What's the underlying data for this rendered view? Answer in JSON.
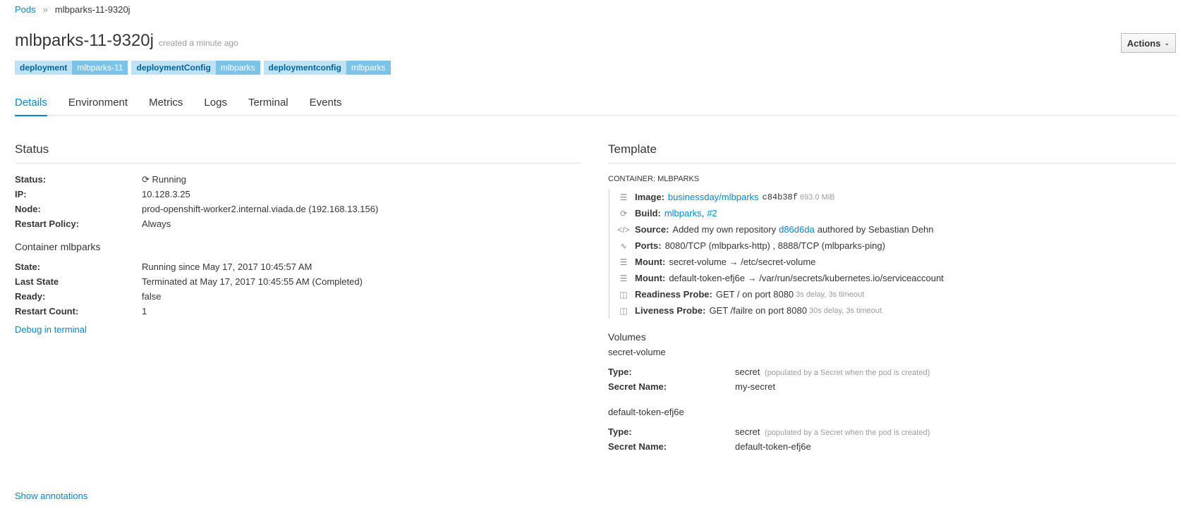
{
  "breadcrumb": {
    "parent": "Pods",
    "separator": "»",
    "current": "mlbparks-11-9320j"
  },
  "header": {
    "title": "mlbparks-11-9320j",
    "created": "created a minute ago",
    "actions_label": "Actions"
  },
  "labels": [
    {
      "key": "deployment",
      "value": "mlbparks-11"
    },
    {
      "key": "deploymentConfig",
      "value": "mlbparks"
    },
    {
      "key": "deploymentconfig",
      "value": "mlbparks"
    }
  ],
  "tabs": [
    "Details",
    "Environment",
    "Metrics",
    "Logs",
    "Terminal",
    "Events"
  ],
  "status": {
    "title": "Status",
    "rows": [
      {
        "key": "Status:",
        "value": "Running"
      },
      {
        "key": "IP:",
        "value": "10.128.3.25"
      },
      {
        "key": "Node:",
        "value": "prod-openshift-worker2.internal.viada.de (192.168.13.156)"
      },
      {
        "key": "Restart Policy:",
        "value": "Always"
      }
    ],
    "container_title": "Container mlbparks",
    "container_rows": [
      {
        "key": "State:",
        "value": "Running since May 17, 2017 10:45:57 AM"
      },
      {
        "key": "Last State",
        "value": "Terminated at May 17, 2017 10:45:55 AM (Completed)"
      },
      {
        "key": "Ready:",
        "value": "false"
      },
      {
        "key": "Restart Count:",
        "value": "1"
      }
    ],
    "debug_link": "Debug in terminal",
    "show_annotations": "Show annotations"
  },
  "template": {
    "title": "Template",
    "container_label": "CONTAINER: MLBPARKS",
    "image": {
      "label": "Image:",
      "link": "businessday/mlbparks",
      "hash": "c84b38f",
      "size": "693.0 MiB"
    },
    "build": {
      "label": "Build:",
      "link1": "mlbparks",
      "comma": ",",
      "link2": "#2"
    },
    "source": {
      "label": "Source:",
      "text1": "Added my own repository",
      "commit": "d86d6da",
      "text2": "authored by Sebastian Dehn"
    },
    "ports": {
      "label": "Ports:",
      "value": "8080/TCP (mlbparks-http) , 8888/TCP (mlbparks-ping)"
    },
    "mount1": {
      "label": "Mount:",
      "value": "secret-volume → /etc/secret-volume"
    },
    "mount2": {
      "label": "Mount:",
      "value": "default-token-efj6e → /var/run/secrets/kubernetes.io/serviceaccount"
    },
    "readiness": {
      "label": "Readiness Probe:",
      "value": "GET / on port 8080",
      "detail": "3s delay, 3s timeout"
    },
    "liveness": {
      "label": "Liveness Probe:",
      "value": "GET /failre on port 8080",
      "detail": "30s delay, 3s timeout"
    },
    "volumes_title": "Volumes",
    "volumes": [
      {
        "name": "secret-volume",
        "type_key": "Type:",
        "type": "secret",
        "type_note": "(populated by a Secret when the pod is created)",
        "secret_key": "Secret Name:",
        "secret": "my-secret"
      },
      {
        "name": "default-token-efj6e",
        "type_key": "Type:",
        "type": "secret",
        "type_note": "(populated by a Secret when the pod is created)",
        "secret_key": "Secret Name:",
        "secret": "default-token-efj6e"
      }
    ]
  },
  "colors": {
    "link": "#0088ce",
    "label_key_bg": "#bee1f4",
    "label_val_bg": "#7dc3e8"
  }
}
